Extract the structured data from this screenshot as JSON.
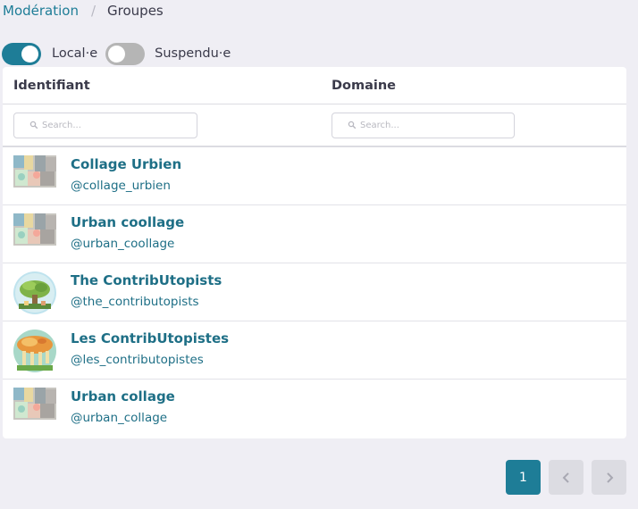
{
  "breadcrumb": {
    "items": [
      "Modération",
      "Groupes"
    ],
    "separator": "/"
  },
  "filters_toggles": [
    {
      "label": "Local·e",
      "checked": true
    },
    {
      "label": "Suspendu·e",
      "checked": false
    }
  ],
  "table": {
    "columns": [
      "Identifiant",
      "Domaine"
    ],
    "search_placeholder": "Search...",
    "rows": [
      {
        "name": "Collage Urbien",
        "handle": "@collage_urbien",
        "avatar": "collage-avatar"
      },
      {
        "name": "Urban coollage",
        "handle": "@urban_coollage",
        "avatar": "collage-avatar"
      },
      {
        "name": "The ContribUtopists",
        "handle": "@the_contributopists",
        "avatar": "tree-avatar"
      },
      {
        "name": "Les ContribUtopistes",
        "handle": "@les_contributopistes",
        "avatar": "mushroom-avatar"
      },
      {
        "name": "Urban collage",
        "handle": "@urban_collage",
        "avatar": "collage-avatar"
      }
    ]
  },
  "pagination": {
    "current_page": "1",
    "prev_icon": "chevron-left-icon",
    "next_icon": "chevron-right-icon"
  },
  "colors": {
    "accent": "#1e7d97",
    "link": "#1e6f86",
    "background": "#efeef4",
    "toggle_off": "#b5b5b5"
  }
}
